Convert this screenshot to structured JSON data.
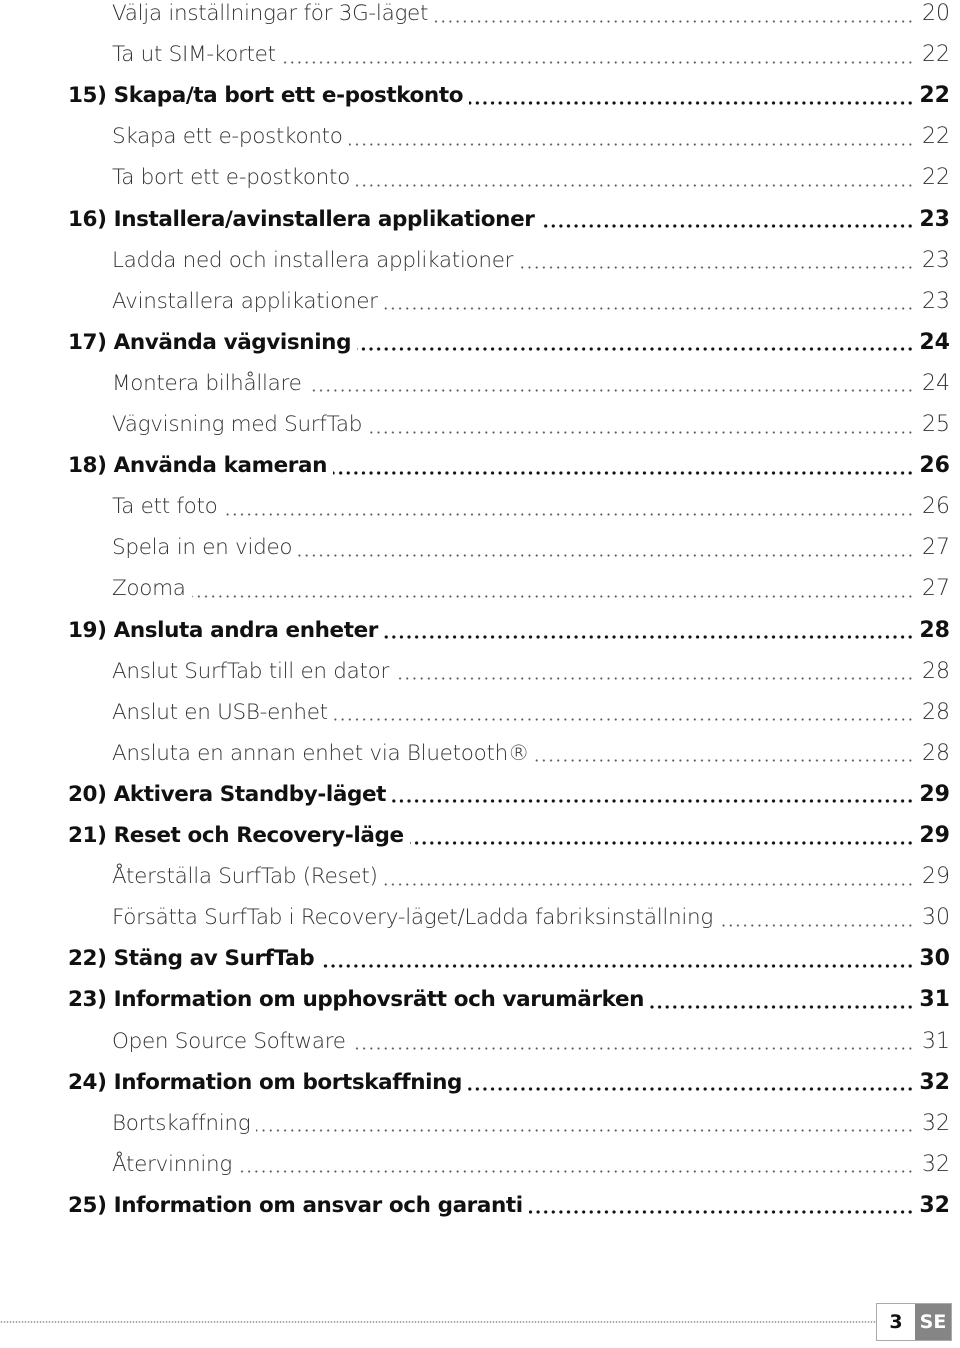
{
  "toc": {
    "entries": [
      {
        "level": "sub",
        "title": "Välja inställningar för 3G-läget",
        "page": "20"
      },
      {
        "level": "sub",
        "title": "Ta ut SIM-kortet",
        "page": "22"
      },
      {
        "level": "main",
        "title": "15) Skapa/ta bort ett e-postkonto",
        "page": "22"
      },
      {
        "level": "sub",
        "title": "Skapa ett e-postkonto",
        "page": "22"
      },
      {
        "level": "sub",
        "title": "Ta bort ett e-postkonto",
        "page": "22"
      },
      {
        "level": "main",
        "title": "16) Installera/avinstallera applikationer",
        "page": "23"
      },
      {
        "level": "sub",
        "title": "Ladda ned och installera applikationer",
        "page": "23"
      },
      {
        "level": "sub",
        "title": "Avinstallera applikationer",
        "page": "23"
      },
      {
        "level": "main",
        "title": "17) Använda vägvisning",
        "page": "24"
      },
      {
        "level": "sub",
        "title": "Montera bilhållare",
        "page": "24"
      },
      {
        "level": "sub",
        "title": "Vägvisning med SurfTab",
        "page": "25"
      },
      {
        "level": "main",
        "title": "18) Använda kameran",
        "page": "26"
      },
      {
        "level": "sub",
        "title": "Ta ett foto",
        "page": "26"
      },
      {
        "level": "sub",
        "title": "Spela in en video",
        "page": "27"
      },
      {
        "level": "sub",
        "title": "Zooma",
        "page": "27"
      },
      {
        "level": "main",
        "title": "19) Ansluta andra enheter",
        "page": "28"
      },
      {
        "level": "sub",
        "title": "Anslut SurfTab till en dator",
        "page": "28"
      },
      {
        "level": "sub",
        "title": "Anslut en USB-enhet",
        "page": "28"
      },
      {
        "level": "sub",
        "title": "Ansluta en annan enhet via Bluetooth®",
        "page": "28"
      },
      {
        "level": "main",
        "title": "20) Aktivera Standby-läget",
        "page": "29"
      },
      {
        "level": "main",
        "title": "21) Reset och Recovery-läge",
        "page": "29"
      },
      {
        "level": "sub",
        "title": "Återställa SurfTab (Reset)",
        "page": "29"
      },
      {
        "level": "sub",
        "title": "Försätta SurfTab i Recovery-läget/Ladda fabriksinställning",
        "page": "30"
      },
      {
        "level": "main",
        "title": "22) Stäng av SurfTab",
        "page": "30"
      },
      {
        "level": "main",
        "title": "23) Information om upphovsrätt och varumärken",
        "page": "31"
      },
      {
        "level": "sub",
        "title": "Open Source Software",
        "page": "31"
      },
      {
        "level": "main",
        "title": "24) Information om bortskaffning",
        "page": "32"
      },
      {
        "level": "sub",
        "title": "Bortskaffning",
        "page": "32"
      },
      {
        "level": "sub",
        "title": "Återvinning",
        "page": "32"
      },
      {
        "level": "main",
        "title": "25)  Information om ansvar och garanti",
        "page": "32"
      }
    ]
  },
  "footer": {
    "page_number": "3",
    "language_code": "SE",
    "language_badge_color": "#858585"
  }
}
